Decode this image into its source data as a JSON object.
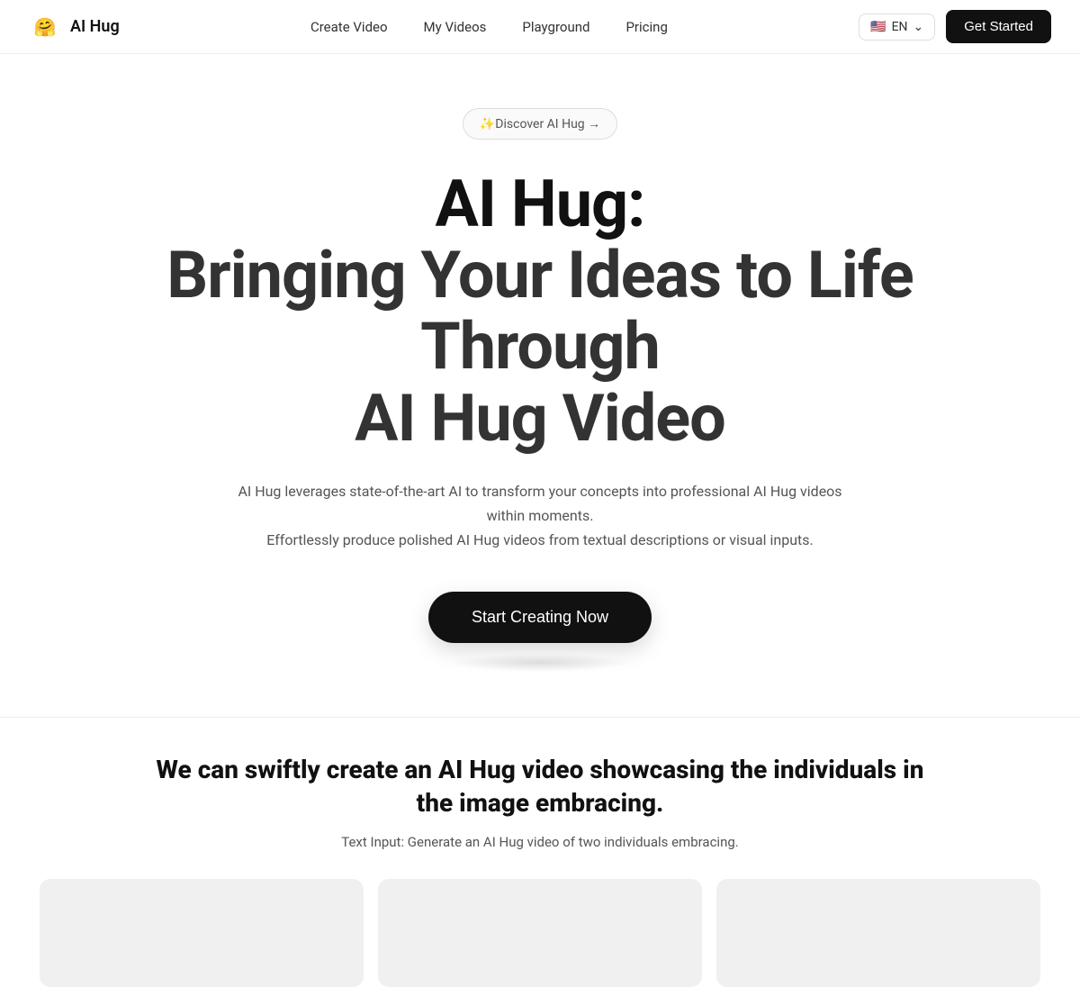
{
  "brand": {
    "logo_emoji": "🤗",
    "name": "AI Hug"
  },
  "nav": {
    "links": [
      {
        "label": "Create Video",
        "id": "create-video"
      },
      {
        "label": "My Videos",
        "id": "my-videos"
      },
      {
        "label": "Playground",
        "id": "playground"
      },
      {
        "label": "Pricing",
        "id": "pricing"
      }
    ],
    "lang_flag": "🇺🇸",
    "lang_code": "EN",
    "cta_label": "Get Started"
  },
  "hero": {
    "badge_text": "✨Discover AI Hug →",
    "title_line1": "AI Hug:",
    "title_line2": "Bringing Your Ideas to Life Through",
    "title_line3": "AI Hug Video",
    "subtitle_line1": "AI Hug leverages state-of-the-art AI to transform your concepts into professional AI Hug videos within moments.",
    "subtitle_line2": "Effortlessly produce polished AI Hug videos from textual descriptions or visual inputs.",
    "cta_label": "Start Creating Now"
  },
  "showcase": {
    "title": "We can swiftly create an AI Hug video showcasing the individuals in the image embracing.",
    "subtitle": "Text Input: Generate an AI Hug video of two individuals embracing."
  }
}
